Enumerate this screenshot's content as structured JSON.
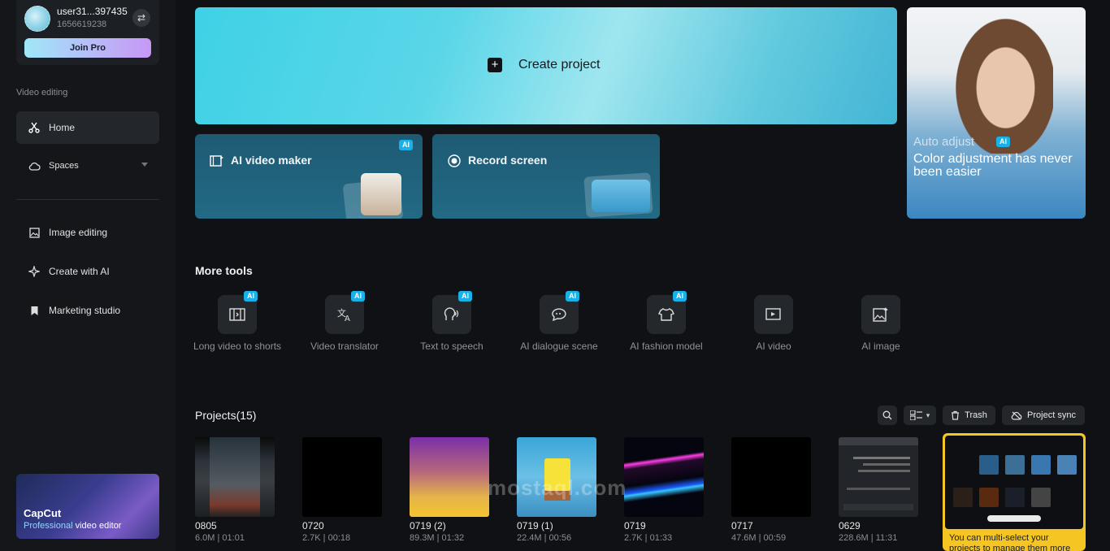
{
  "user": {
    "name": "user31...397435",
    "id": "1656619238",
    "join_label": "Join Pro"
  },
  "sidebar": {
    "section": "Video editing",
    "items": [
      {
        "label": "Home",
        "icon": "scissors-icon"
      },
      {
        "label": "Spaces",
        "icon": "cloud-icon"
      },
      {
        "label": "Image editing",
        "icon": "image-icon"
      },
      {
        "label": "Create with AI",
        "icon": "sparkle-icon"
      },
      {
        "label": "Marketing studio",
        "icon": "bookmark-icon"
      }
    ],
    "promo": {
      "title": "CapCut",
      "sub_a": "Professional",
      "sub_b": " video editor"
    }
  },
  "create": {
    "label": "Create project"
  },
  "cards": {
    "ai_video_maker": "AI video maker",
    "record_screen": "Record screen",
    "ai_badge": "AI"
  },
  "ad": {
    "line1": "Auto adjust",
    "line2": "Color adjustment has never been easier",
    "badge": "AI"
  },
  "more_tools": {
    "title": "More tools",
    "items": [
      {
        "label": "Long video to shorts",
        "ai": "AI"
      },
      {
        "label": "Video translator",
        "ai": "AI"
      },
      {
        "label": "Text to speech",
        "ai": "AI"
      },
      {
        "label": "AI dialogue scene",
        "ai": "AI"
      },
      {
        "label": "AI fashion model",
        "ai": "AI"
      },
      {
        "label": "AI video"
      },
      {
        "label": "AI image"
      }
    ]
  },
  "projects": {
    "title": "Projects(15)",
    "trash_label": "Trash",
    "sync_label": "Project sync",
    "items": [
      {
        "name": "0805",
        "meta": "6.0M | 01:01"
      },
      {
        "name": "0720",
        "meta": "2.7K | 00:18"
      },
      {
        "name": "0719 (2)",
        "meta": "89.3M | 01:32"
      },
      {
        "name": "0719 (1)",
        "meta": "22.4M | 00:56"
      },
      {
        "name": "0719",
        "meta": "2.7K | 01:33"
      },
      {
        "name": "0717",
        "meta": "47.6M | 00:59"
      },
      {
        "name": "0629",
        "meta": "228.6M | 11:31"
      }
    ],
    "tip": "You can multi-select your projects to manage them more"
  },
  "watermark": "mostaql.com",
  "colors": {
    "accent": "#17b2ea",
    "create_card": "#4fd3e7",
    "tip_bg": "#f5c623"
  }
}
